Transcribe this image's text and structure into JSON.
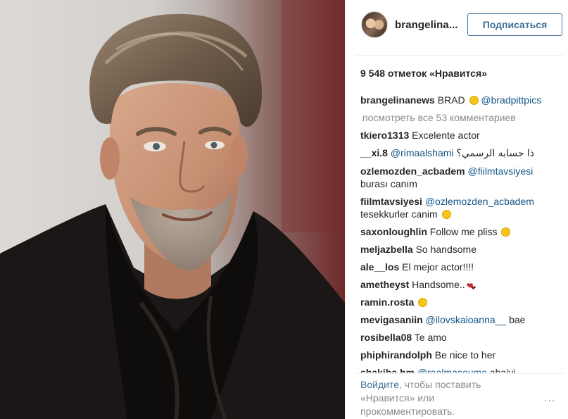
{
  "post": {
    "image_alt": "Portrait of a man with swept-back hair and a grey beard wearing a dark scarf",
    "author": {
      "username": "brangelina..."
    },
    "follow_label": "Подписаться",
    "likes_text": "9 548 отметок «Нравится»"
  },
  "comments": [
    {
      "user": "brangelinanews",
      "text": "BRAD",
      "emoji": "heart-eyes",
      "mention": "@bradpittpics"
    },
    {
      "user": "tkiero1313",
      "text": "Excelente actor"
    },
    {
      "user": "__xi.8",
      "mention": "@rimaalshami",
      "text": "ذا حسابه الرسمي؟"
    },
    {
      "user": "ozlemozden_acbadem",
      "mention": "@fiilmtavsiyesi",
      "text": "burası canım"
    },
    {
      "user": "fiilmtavsiyesi",
      "mention": "@ozlemozden_acbadem",
      "text": "tesekkurler canim",
      "emoji": "grinning"
    },
    {
      "user": "saxonloughlin",
      "text": "Follow me pliss",
      "emoji": "persevering"
    },
    {
      "user": "meljazbella",
      "text": "So handsome"
    },
    {
      "user": "ale__los",
      "text": "El mejor actor!!!!"
    },
    {
      "user": "ametheyst",
      "text": "Handsome..",
      "emoji": "two-hearts"
    },
    {
      "user": "ramin.rosta",
      "emoji": "smiling"
    },
    {
      "user": "mevigasaniin",
      "mention": "@ilovskaioanna__",
      "text": "bae"
    },
    {
      "user": "rosibella08",
      "text": "Te amo"
    },
    {
      "user": "phiphirandolph",
      "text": "Be nice to her"
    },
    {
      "user": "shakiba.hm",
      "mention": "@realmasoume",
      "text": "ahaiyi"
    }
  ],
  "view_all_comments": "посмотреть все 53 комментариев",
  "login_prompt": {
    "link": "Войдите",
    "rest_line1": ", чтобы поставить",
    "line2": "«Нравится» или",
    "line3": "прокомментировать."
  },
  "more_label": "..."
}
